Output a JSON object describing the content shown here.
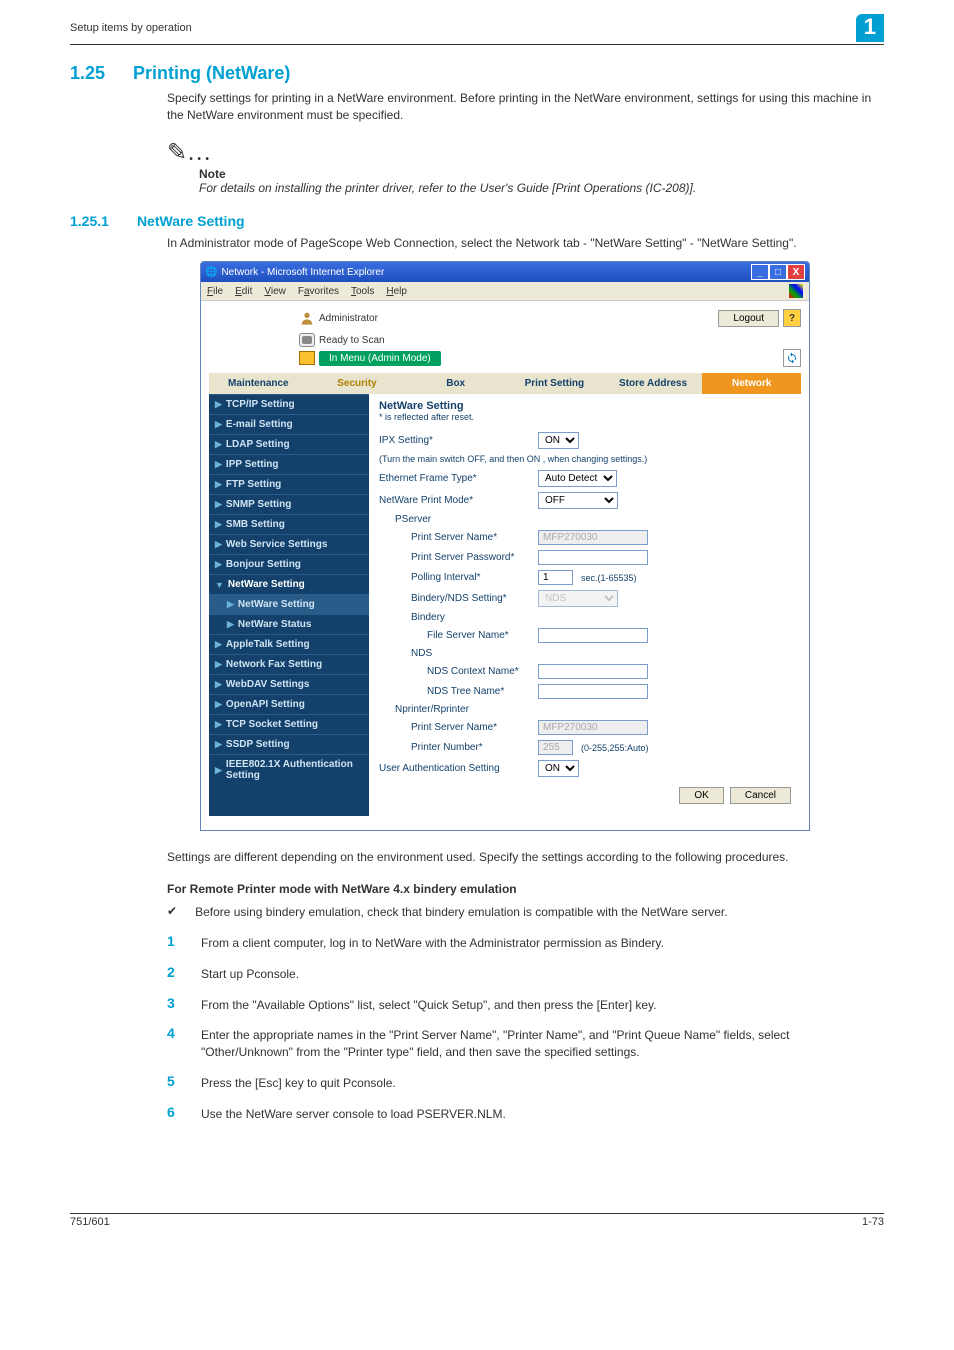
{
  "header": {
    "breadcrumb": "Setup items by operation",
    "page_badge_top": "1"
  },
  "section": {
    "num125": "1.25",
    "title125": "Printing (NetWare)",
    "intro125": "Specify settings for printing in a NetWare environment. Before printing in the NetWare environment, settings for using this machine in the NetWare environment must be specified.",
    "note_symbol": "✎…",
    "note_label": "Note",
    "note_text": "For details on installing the printer driver, refer to the User's Guide [Print Operations (IC-208)].",
    "num1251": "1.25.1",
    "title1251": "NetWare Setting",
    "intro1251": "In Administrator mode of PageScope Web Connection, select the Network tab - \"NetWare Setting\" - \"NetWare Setting\"."
  },
  "win": {
    "title": "Network - Microsoft Internet Explorer",
    "menu": {
      "file": "File",
      "edit": "Edit",
      "view": "View",
      "favorites": "Favorites",
      "tools": "Tools",
      "help": "Help"
    },
    "admin_label": "Administrator",
    "logout": "Logout",
    "help": "?",
    "ready": "Ready to Scan",
    "mode": "In Menu (Admin Mode)",
    "tabs": {
      "maintenance": "Maintenance",
      "security": "Security",
      "box": "Box",
      "print": "Print Setting",
      "store": "Store Address",
      "network": "Network"
    },
    "side": {
      "tcpip": "TCP/IP Setting",
      "email": "E-mail Setting",
      "ldap": "LDAP Setting",
      "ipp": "IPP Setting",
      "ftp": "FTP Setting",
      "snmp": "SNMP Setting",
      "smb": "SMB Setting",
      "wss": "Web Service Settings",
      "bonjour": "Bonjour Setting",
      "netware": "NetWare Setting",
      "netware_setting": "NetWare Setting",
      "netware_status": "NetWare Status",
      "appletalk": "AppleTalk Setting",
      "netfax": "Network Fax Setting",
      "webdav": "WebDAV Settings",
      "openapi": "OpenAPI Setting",
      "tcpsocket": "TCP Socket Setting",
      "ssdp": "SSDP Setting",
      "ieee": "IEEE802.1X Authentication Setting"
    },
    "pane": {
      "title": "NetWare Setting",
      "reflect": "* is reflected after reset.",
      "ipx": "IPX Setting*",
      "ipx_val": "ON",
      "hint": "(Turn the main switch OFF, and then ON , when changing settings.)",
      "eftype": "Ethernet Frame Type*",
      "eftype_val": "Auto Detect",
      "mode": "NetWare Print Mode*",
      "mode_val": "OFF",
      "pserver": "PServer",
      "psname": "Print Server Name*",
      "psname_val": "MFP270030",
      "pspwd": "Print Server Password*",
      "poll": "Polling Interval*",
      "poll_val": "1",
      "poll_cap": "sec.(1-65535)",
      "bnds": "Bindery/NDS Setting*",
      "bnds_val": "NDS",
      "bindery": "Bindery",
      "fsname": "File Server Name*",
      "nds": "NDS",
      "ndsctx": "NDS Context Name*",
      "ndstree": "NDS Tree Name*",
      "nrp": "Nprinter/Rprinter",
      "npsname": "Print Server Name*",
      "npsname_val": "MFP270030",
      "prnnum": "Printer Number*",
      "prnnum_val": "255",
      "prnnum_cap": "(0-255,255:Auto)",
      "uauth": "User Authentication Setting",
      "uauth_val": "ON",
      "ok": "OK",
      "cancel": "Cancel"
    }
  },
  "after": "Settings are different depending on the environment used. Specify the settings according to the following procedures.",
  "subhead": "For Remote Printer mode with NetWare 4.x bindery emulation",
  "check": "✔",
  "check_txt": "Before using bindery emulation, check that bindery emulation is compatible with the NetWare server.",
  "steps": {
    "s1n": "1",
    "s1": "From a client computer, log in to NetWare with the Administrator permission as Bindery.",
    "s2n": "2",
    "s2": "Start up Pconsole.",
    "s3n": "3",
    "s3": "From the \"Available Options\" list, select \"Quick Setup\", and then press the [Enter] key.",
    "s4n": "4",
    "s4": "Enter the appropriate names in the \"Print Server Name\", \"Printer Name\", and \"Print Queue Name\" fields, select \"Other/Unknown\" from the \"Printer type\" field, and then save the specified settings.",
    "s5n": "5",
    "s5": "Press the [Esc] key to quit Pconsole.",
    "s6n": "6",
    "s6": "Use the NetWare server console to load PSERVER.NLM."
  },
  "footer": {
    "left": "751/601",
    "right": "1-73"
  }
}
